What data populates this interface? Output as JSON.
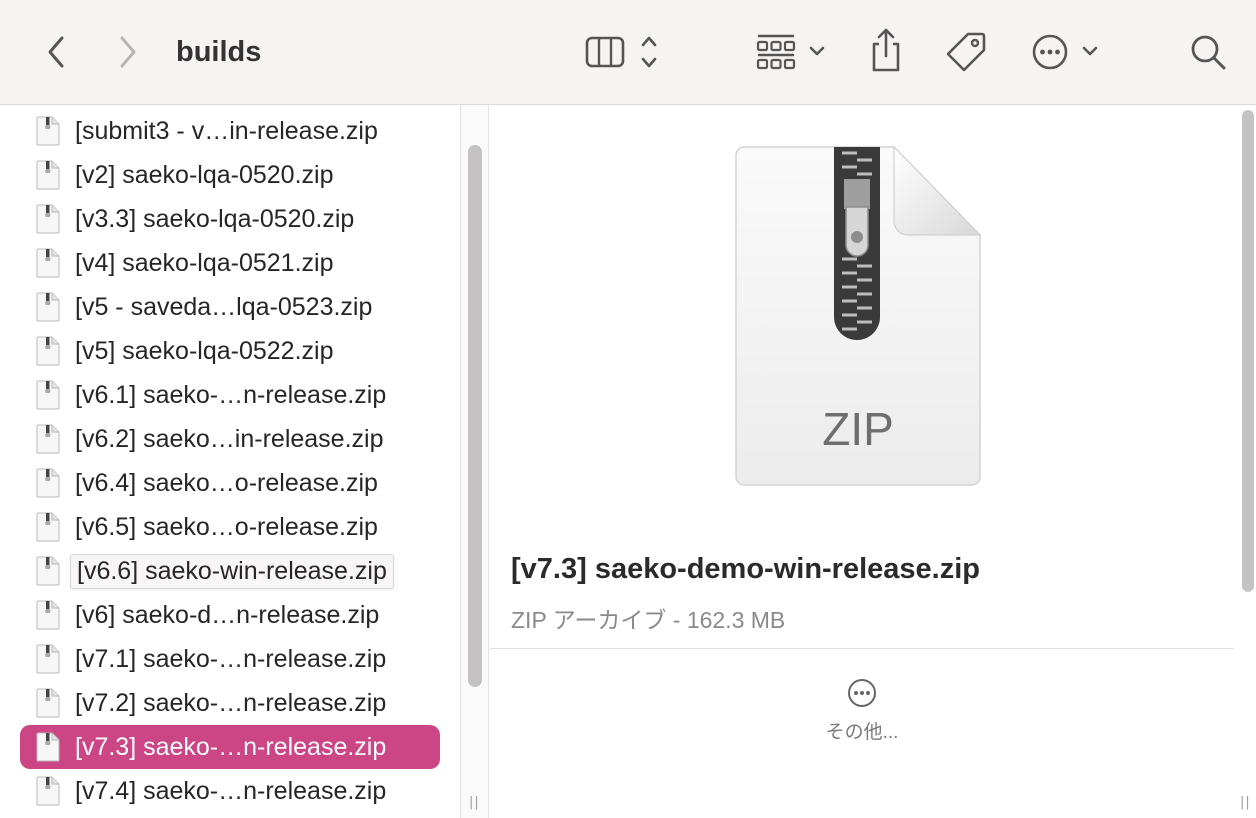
{
  "toolbar": {
    "title": "builds",
    "back_icon": "chevron-left-icon",
    "forward_icon": "chevron-right-icon",
    "view_icon": "columns-view-icon",
    "group_icon": "grid-group-icon",
    "share_icon": "share-icon",
    "tag_icon": "tag-icon",
    "action_icon": "ellipsis-circle-icon",
    "search_icon": "search-icon"
  },
  "files": [
    {
      "name": "[submit3 - v…in-release.zip"
    },
    {
      "name": "[v2] saeko-lqa-0520.zip"
    },
    {
      "name": "[v3.3] saeko-lqa-0520.zip"
    },
    {
      "name": "[v4] saeko-lqa-0521.zip"
    },
    {
      "name": "[v5 - saveda…lqa-0523.zip"
    },
    {
      "name": "[v5] saeko-lqa-0522.zip"
    },
    {
      "name": "[v6.1] saeko-…n-release.zip"
    },
    {
      "name": "[v6.2] saeko…in-release.zip"
    },
    {
      "name": "[v6.4] saeko…o-release.zip"
    },
    {
      "name": "[v6.5] saeko…o-release.zip"
    },
    {
      "name": "[v6.6] saeko-win-release.zip"
    },
    {
      "name": "[v6] saeko-d…n-release.zip"
    },
    {
      "name": "[v7.1] saeko-…n-release.zip"
    },
    {
      "name": "[v7.2] saeko-…n-release.zip"
    },
    {
      "name": "[v7.3] saeko-…n-release.zip"
    },
    {
      "name": "[v7.4] saeko-…n-release.zip"
    }
  ],
  "selected_index": 14,
  "renaming_index": 10,
  "preview": {
    "icon_label": "ZIP",
    "file_name": "[v7.3] saeko-demo-win-release.zip",
    "meta": "ZIP アーカイブ - 162.3 MB",
    "more_label": "その他..."
  },
  "colors": {
    "selection": "#cc4585",
    "toolbar_bg": "#f6f3f3"
  }
}
